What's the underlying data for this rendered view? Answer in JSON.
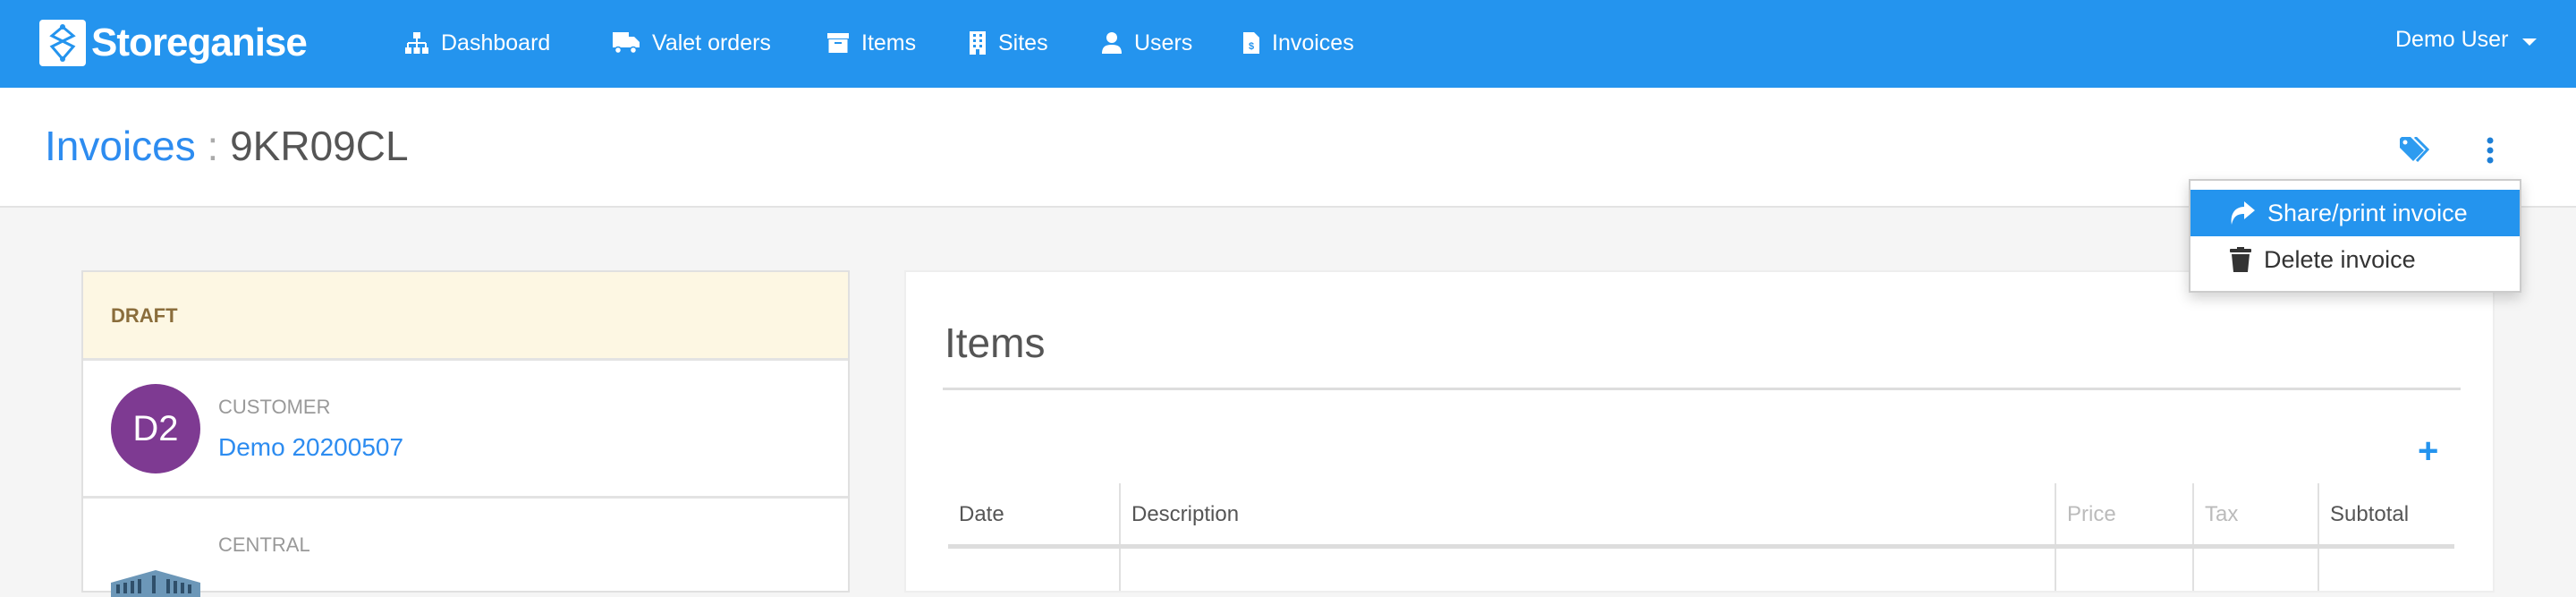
{
  "brand": {
    "name": "Storeganise",
    "color": "#2494ee"
  },
  "nav": {
    "items": [
      {
        "label": "Dashboard",
        "icon": "sitemap-icon"
      },
      {
        "label": "Valet orders",
        "icon": "truck-icon"
      },
      {
        "label": "Items",
        "icon": "archive-icon"
      },
      {
        "label": "Sites",
        "icon": "building-icon"
      },
      {
        "label": "Users",
        "icon": "user-icon"
      },
      {
        "label": "Invoices",
        "icon": "invoice-icon"
      }
    ],
    "user": "Demo User"
  },
  "header": {
    "crumb": "Invoices",
    "separator": ":",
    "invoice_id": "9KR09CL"
  },
  "menu": {
    "items": [
      {
        "label": "Share/print invoice",
        "icon": "share-icon"
      },
      {
        "label": "Delete invoice",
        "icon": "trash-icon"
      }
    ]
  },
  "summary": {
    "status": "DRAFT",
    "customer": {
      "label": "CUSTOMER",
      "initials": "D2",
      "name": "Demo 20200507",
      "avatar_color": "#7e3a92"
    },
    "site": {
      "label": "CENTRAL"
    }
  },
  "items": {
    "title": "Items",
    "add_label": "+",
    "columns": [
      "Date",
      "Description",
      "Price",
      "Tax",
      "Subtotal"
    ]
  }
}
